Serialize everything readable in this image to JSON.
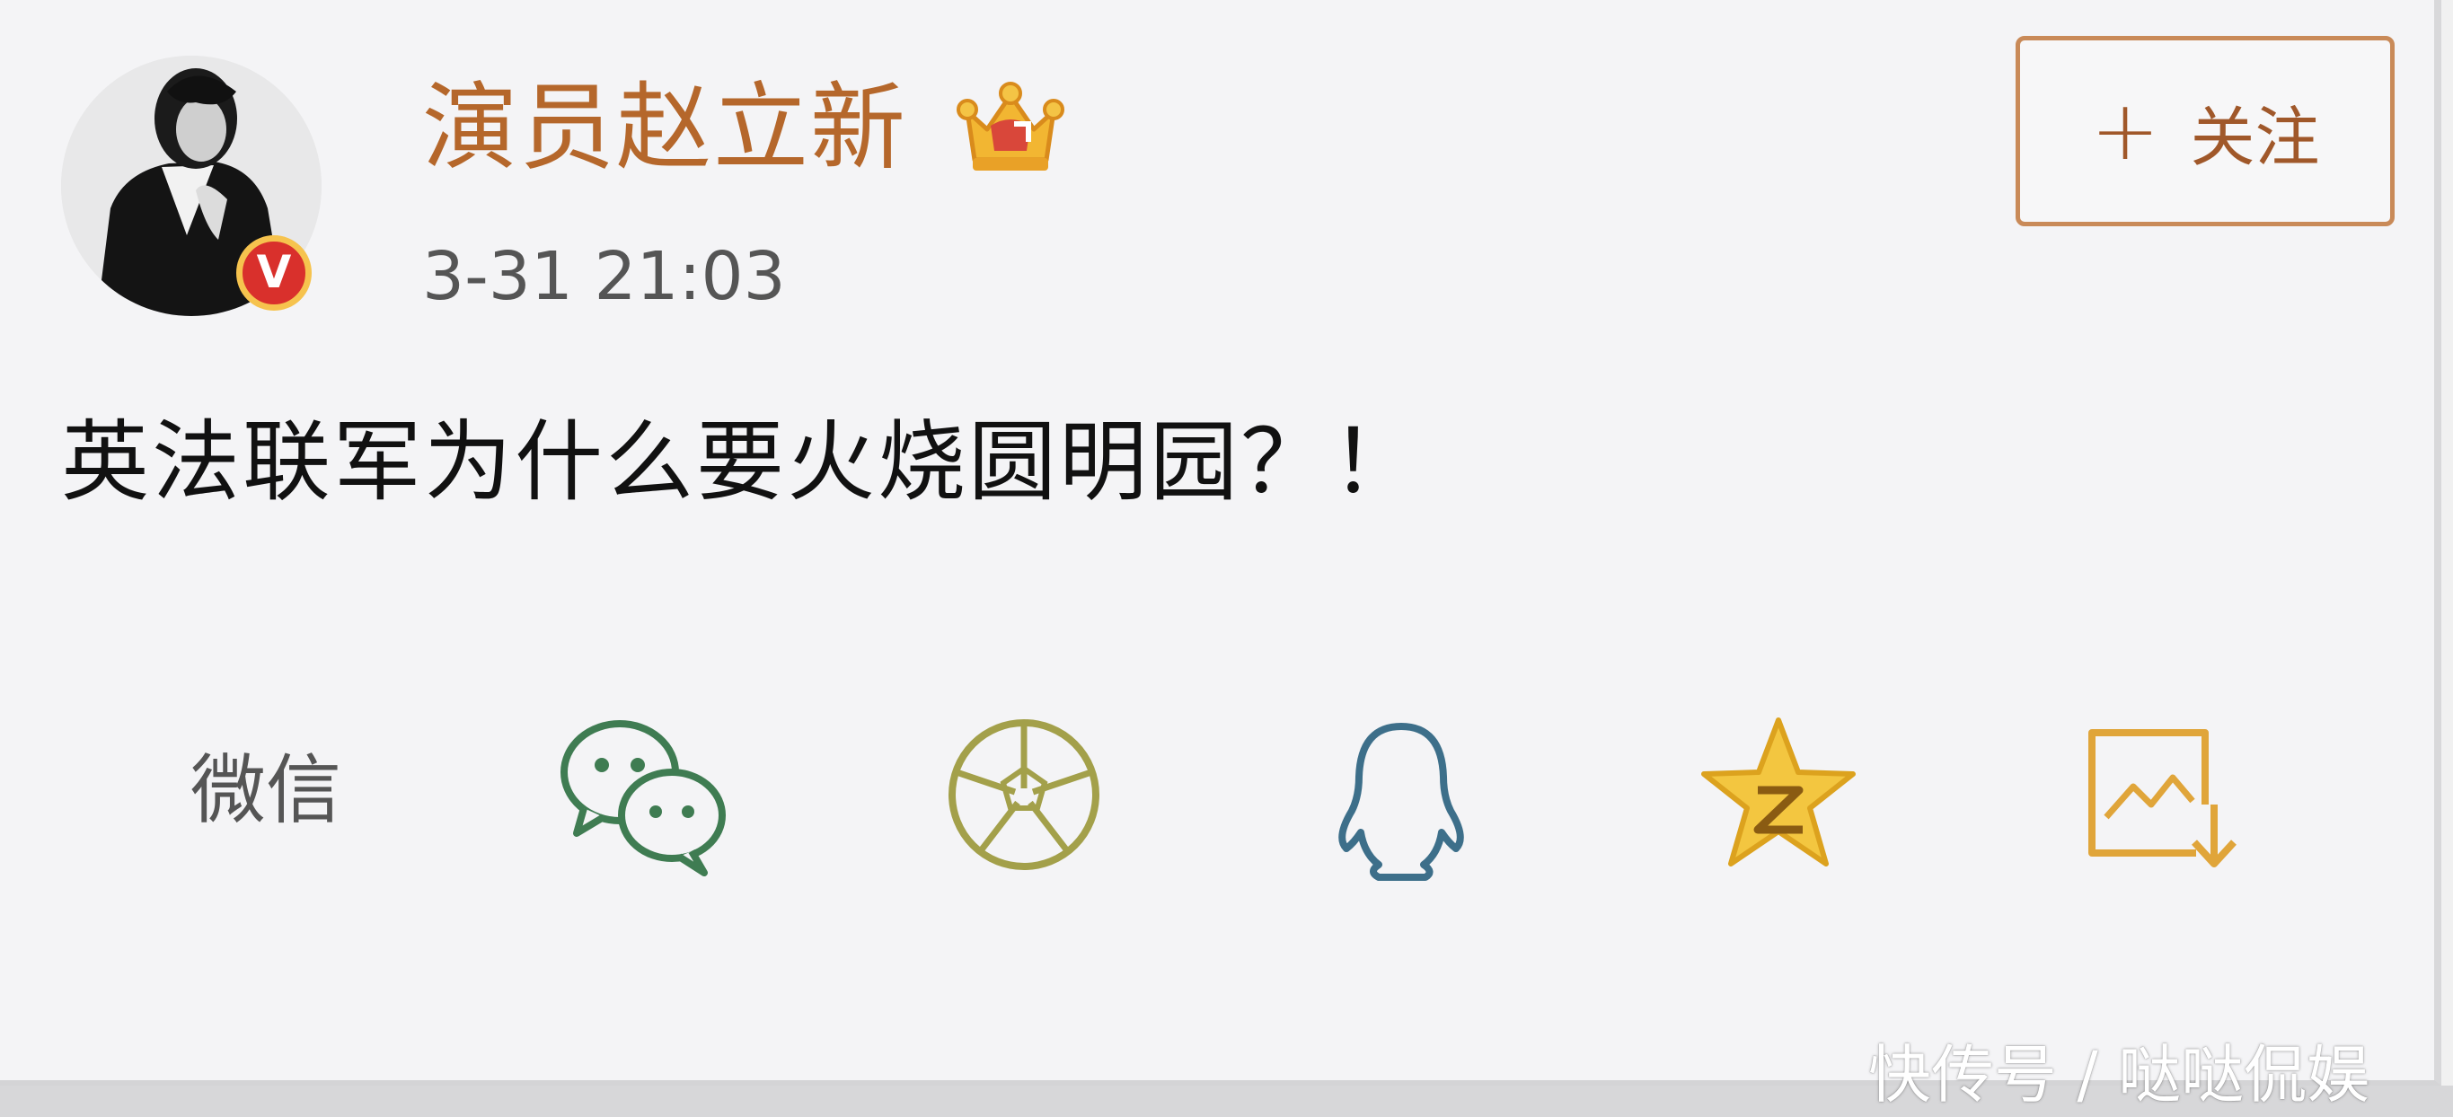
{
  "post": {
    "author": {
      "name": "演员赵立新",
      "verified_badge": "V",
      "badge_color": "#d9302c",
      "name_color": "#b5672b"
    },
    "timestamp": "3-31 21:03",
    "follow_button": {
      "plus": "+",
      "label": "关注"
    },
    "content": "英法联军为什么要火烧圆明园？！"
  },
  "share": {
    "label": "微信",
    "icons": [
      "wechat-icon",
      "moments-icon",
      "qq-icon",
      "qzone-icon",
      "save-image-icon"
    ],
    "colors": {
      "wechat": "#3f7c52",
      "moments": "#a3a04a",
      "qq": "#3d6f8a",
      "qzone": "#e7b624",
      "save_image": "#e0a53a"
    }
  },
  "watermark": "快传号 / 哒哒侃娱"
}
